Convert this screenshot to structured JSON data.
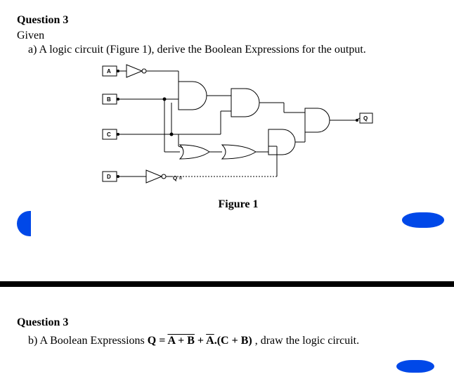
{
  "q3": {
    "header": "Question 3",
    "given": "Given",
    "part_a": "a) A logic circuit (Figure 1), derive the Boolean Expressions for the output.",
    "figure_caption": "Figure 1",
    "part_b_prefix": "b) A Boolean Expressions ",
    "part_b_eq_Q": "Q = ",
    "part_b_eq_term1": "A + B",
    "part_b_eq_plus": " + ",
    "part_b_eq_Abar": "A",
    "part_b_eq_term2": ".(C + B)",
    "part_b_suffix": " , draw the logic circuit."
  },
  "circuit": {
    "inputs": {
      "A": "A",
      "B": "B",
      "C": "C",
      "D": "D"
    },
    "output": "Q",
    "feedback": "Q ="
  }
}
